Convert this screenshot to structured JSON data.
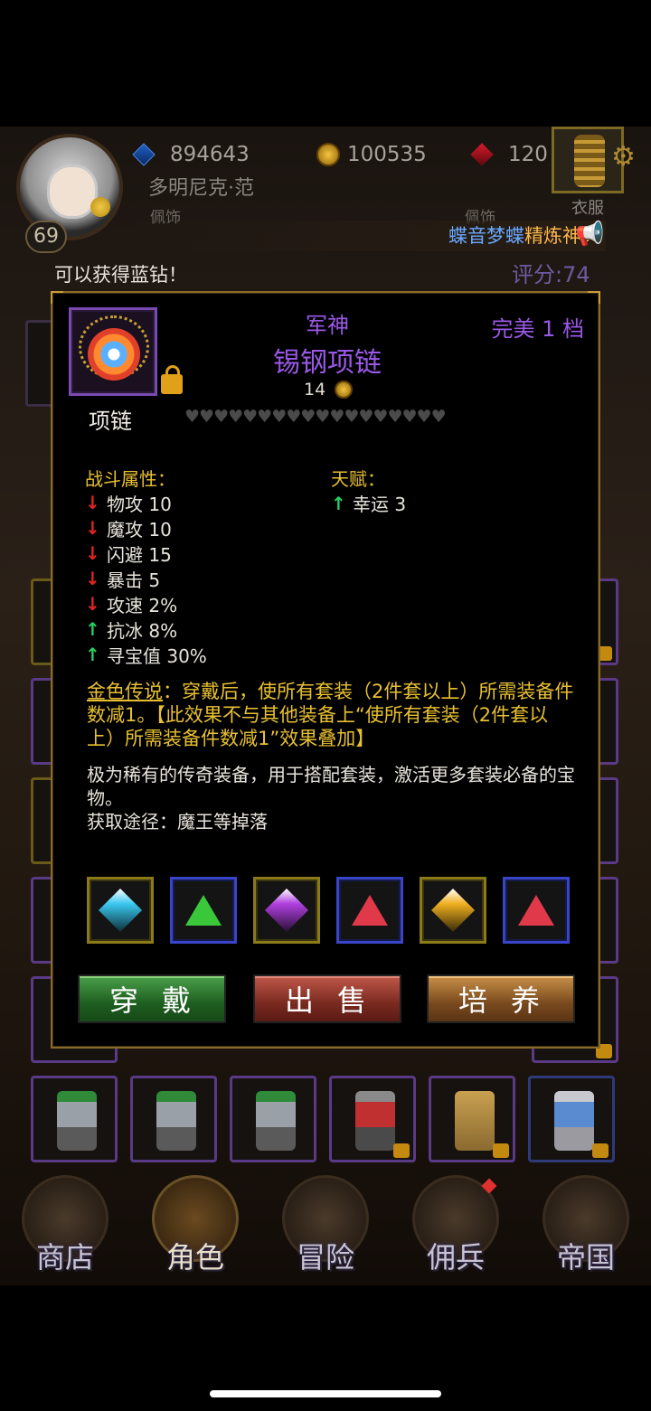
{
  "hud": {
    "blue_diamonds": "894643",
    "gold": "100535",
    "red_gems": "120",
    "player_name": "多明尼克·范",
    "level": "69",
    "slot_left_label": "佩饰",
    "slot_right_label": "佩饰",
    "clothes_label": "衣服",
    "banner_part1": "蝶音梦蝶",
    "banner_part2": "精炼神兵",
    "notice": "可以获得蓝钻！",
    "score": "评分:74"
  },
  "item": {
    "prefix": "军神",
    "name": "锡钢项链",
    "grade": "完美 1 档",
    "price": "14",
    "type": "项链",
    "hearts": "♥♥♥♥♥♥♥♥♥♥♥♥♥♥♥♥♥♥",
    "combat_title": "战斗属性：",
    "stats": [
      {
        "label": "物攻 10",
        "trend": "down"
      },
      {
        "label": "魔攻 10",
        "trend": "down"
      },
      {
        "label": "闪避 15",
        "trend": "down"
      },
      {
        "label": "暴击 5",
        "trend": "down"
      },
      {
        "label": "攻速 2%",
        "trend": "down"
      },
      {
        "label": "抗冰 8%",
        "trend": "up"
      },
      {
        "label": "寻宝值 30%",
        "trend": "up"
      }
    ],
    "talent_title": "天赋：",
    "talent": "幸运 3",
    "legend_name": "金色传说",
    "legend_text": "：穿戴后，使所有套装（2件套以上）所需装备件数减1。【此效果不与其他装备上“使所有套装（2件套以上）所需装备件数减1”效果叠加】",
    "desc_line1": "极为稀有的传奇装备，用于搭配套装，激活更多套装必备的宝物。",
    "desc_line2": "获取途径：魔王等掉落",
    "gems": [
      {
        "name": "cyan-diamond-gem",
        "color": "#3ac8f0",
        "frame": "gold",
        "shape": "diamond"
      },
      {
        "name": "green-triangle-gem",
        "color": "#3ac83a",
        "frame": "blue",
        "shape": "tri"
      },
      {
        "name": "purple-diamond-gem",
        "color": "#b040e0",
        "frame": "gold",
        "shape": "diamond"
      },
      {
        "name": "red-triangle-gem",
        "color": "#e03a4a",
        "frame": "blue",
        "shape": "tri"
      },
      {
        "name": "yellow-diamond-gem",
        "color": "#f0b020",
        "frame": "gold",
        "shape": "diamond"
      },
      {
        "name": "red-triangle-gem",
        "color": "#e03a4a",
        "frame": "blue",
        "shape": "tri"
      }
    ]
  },
  "buttons": {
    "wear": "穿戴",
    "sell": "出售",
    "train": "培养"
  },
  "nav": {
    "shop": "商店",
    "character": "角色",
    "adventure": "冒险",
    "mercenary": "佣兵",
    "empire": "帝国"
  },
  "colors": {
    "accent_purple": "#9a58e6",
    "gold_text": "#e8c032",
    "panel_border": "#8a6a28"
  }
}
